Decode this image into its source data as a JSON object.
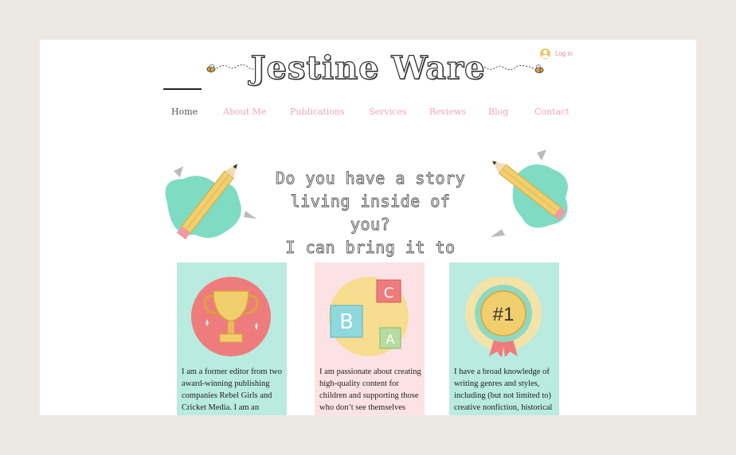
{
  "site": {
    "title": "Jestine Ware",
    "login_label": "Log in"
  },
  "nav": {
    "items": [
      {
        "label": "Home",
        "active": true
      },
      {
        "label": "About Me"
      },
      {
        "label": "Publications"
      },
      {
        "label": "Services"
      },
      {
        "label": "Reviews"
      },
      {
        "label": "Blog"
      },
      {
        "label": "Contact"
      }
    ]
  },
  "hero": {
    "line1": "Do you have a story",
    "line2": "living inside of you?",
    "line3": "I can bring it to life."
  },
  "cards": [
    {
      "icon": "trophy-icon",
      "text": "I am a former editor from two award-winning publishing companies Rebel Girls and Cricket Media. I am an"
    },
    {
      "icon": "abc-blocks-icon",
      "text": "I am passionate about creating high-quality content for children and supporting those who don’t see themselves"
    },
    {
      "icon": "number-one-badge-icon",
      "badge_text": "#1",
      "text": "I have a broad knowledge of writing genres and styles, including (but not limited to) creative nonfiction, historical"
    }
  ],
  "colors": {
    "background": "#ece9e3",
    "nav_link": "#f1a7b6",
    "mint": "#b9ebe0",
    "pink": "#fde2e5"
  }
}
